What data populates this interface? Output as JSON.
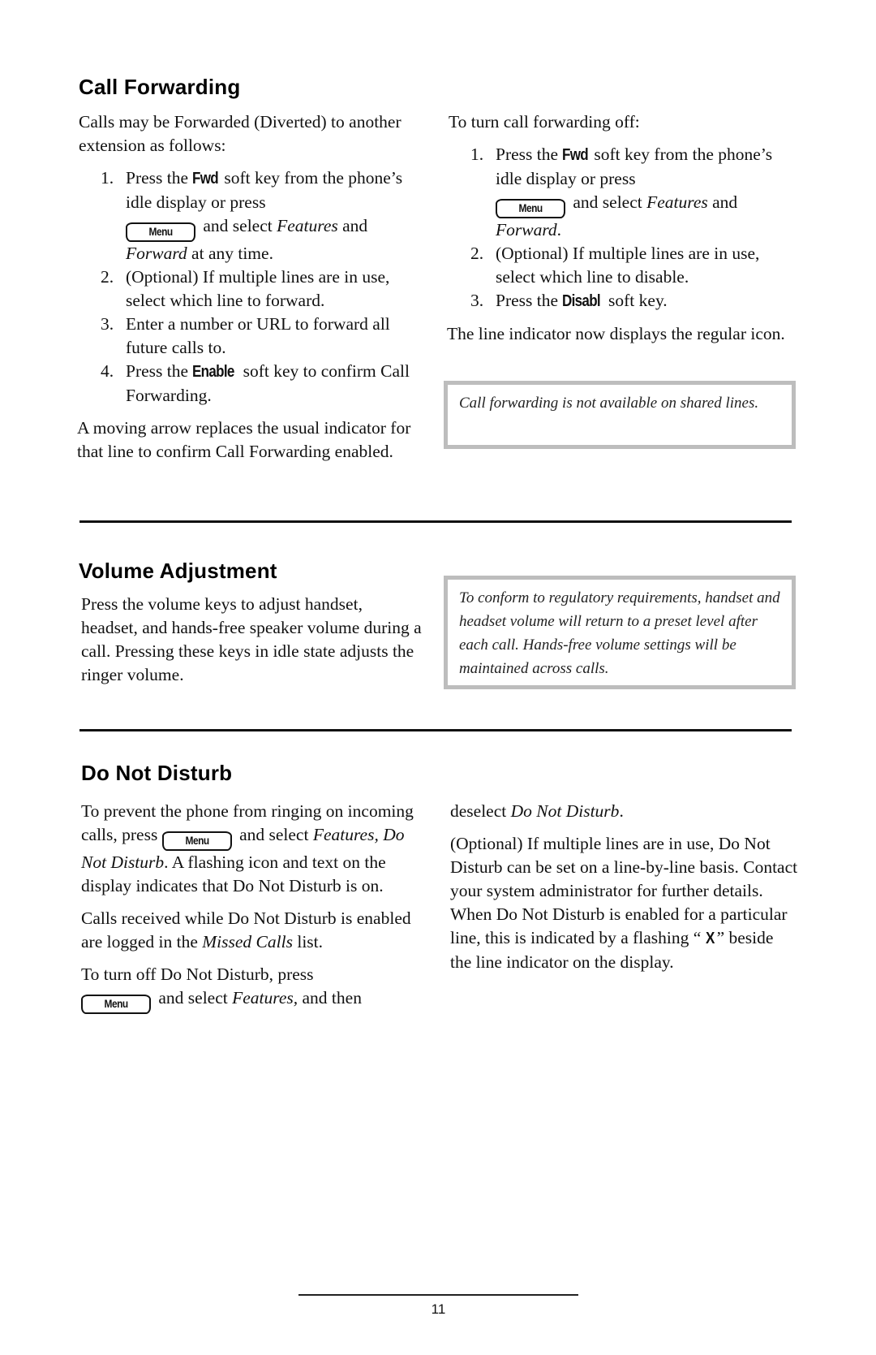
{
  "call_forwarding": {
    "title": "Call Forwarding",
    "intro": "Calls may be Forwarded (Diverted) to another extension as follows:",
    "steps": [
      {
        "num": "1.",
        "pre": "Press the ",
        "key": "Fwd",
        "post": " soft key from the phone’s idle display or press",
        "menu_label": "Menu",
        "after_menu": " and select ",
        "italic1": "Features",
        "mid": " and ",
        "italic2": "Forward",
        "tail": " at any time."
      },
      {
        "num": "2.",
        "text": "(Optional) If multiple lines are in use, select which line to forward."
      },
      {
        "num": "3.",
        "text": "Enter a number or URL to forward all future calls to."
      },
      {
        "num": "4.",
        "pre": "Press the ",
        "key": "Enable",
        "post": " soft key to confirm Call Forwarding."
      }
    ],
    "outro": "A moving arrow replaces the usual indicator for that line to confirm Call Forwarding enabled.",
    "off_intro": "To turn call forwarding off:",
    "off_steps": [
      {
        "num": "1.",
        "pre": "Press the ",
        "key": "Fwd",
        "post": " soft key from the phone’s idle display or press",
        "menu_label": "Menu",
        "after_menu": " and select ",
        "italic1": "Features",
        "mid": " and ",
        "italic2": "Forward",
        "tail": "."
      },
      {
        "num": "2.",
        "text": "(Optional) If multiple lines are in use, select which line to disable."
      },
      {
        "num": "3.",
        "pre": "Press the ",
        "key": "Disabl",
        "post": " soft key."
      }
    ],
    "off_outro": "The line indicator now displays the regular icon.",
    "note": "Call forwarding is not available on shared lines."
  },
  "volume_adjustment": {
    "title": "Volume Adjustment",
    "body": "Press the volume keys to adjust handset, headset, and hands-free speaker volume during a call.  Pressing these keys in idle state adjusts the ringer volume.",
    "note": "To conform to regulatory requirements, handset and headset volume will return to a preset level after each call.  Hands-free volume settings will be maintained across calls."
  },
  "do_not_disturb": {
    "title": "Do Not Disturb",
    "p1_pre": "To prevent the phone from ringing on incoming calls, press ",
    "p1_menu": "Menu",
    "p1_mid": " and select ",
    "p1_italic": "Features, Do Not Disturb",
    "p1_post": ".  A flashing icon and text on the display indicates that Do Not Disturb is on.",
    "p2_pre": "Calls received while Do Not Disturb is enabled are logged in the ",
    "p2_italic": "Missed Calls",
    "p2_post": " list.",
    "p3_pre": "To turn off Do Not Disturb, press",
    "p3_menu": "Menu",
    "p3_mid": " and select ",
    "p3_italic": "Features,",
    "p3_post": " and then",
    "p4_pre": "deselect ",
    "p4_italic": "Do Not Disturb",
    "p4_post": ".",
    "p5_pre": "(Optional) If multiple lines are in use, Do Not Disturb can be set on a line-by-line basis.  Contact your system administrator for further details.  When Do Not Disturb is enabled for a particular line, this is indicated by a flashing “ ",
    "p5_key": "X",
    "p5_post": " ” beside the line indicator on the display."
  },
  "footer": {
    "page_number": "11"
  }
}
